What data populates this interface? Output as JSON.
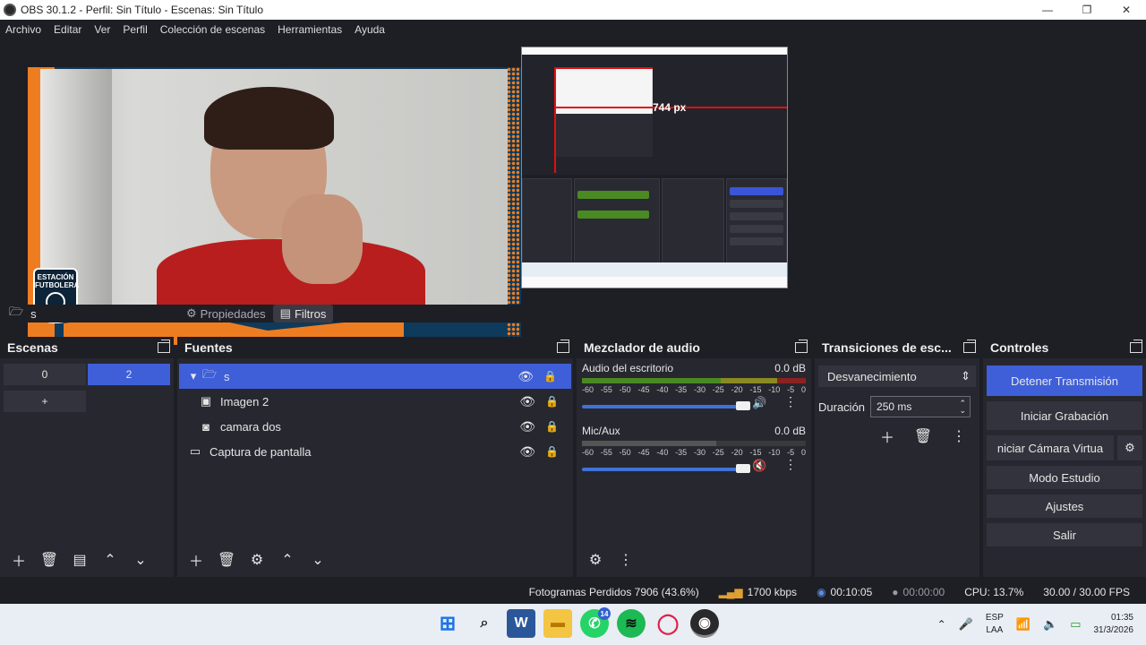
{
  "window": {
    "title": "OBS 30.1.2 - Perfil: Sin Título - Escenas: Sin Título",
    "minimize": "—",
    "maximize": "❐",
    "close": "✕"
  },
  "menu": {
    "items": [
      "Archivo",
      "Editar",
      "Ver",
      "Perfil",
      "Colección de escenas",
      "Herramientas",
      "Ayuda"
    ]
  },
  "preview": {
    "badge_line1": "ESTACIÓN",
    "badge_line2": "FUTBOLERA",
    "screen_label": "744 px"
  },
  "context": {
    "source_name": "s",
    "properties_label": "Propiedades",
    "filters_label": "Filtros"
  },
  "scenes": {
    "title": "Escenas",
    "buttons": [
      "0",
      "2",
      "+"
    ]
  },
  "sources": {
    "title": "Fuentes",
    "items": [
      {
        "name": "s",
        "icon": "folder-icon"
      },
      {
        "name": "Imagen 2",
        "icon": "image-icon"
      },
      {
        "name": "camara dos",
        "icon": "camera-icon"
      },
      {
        "name": "Captura de pantalla",
        "icon": "monitor-icon"
      }
    ]
  },
  "mixer": {
    "title": "Mezclador de audio",
    "tracks": [
      {
        "name": "Audio del escritorio",
        "level": "0.0 dB",
        "muted": false
      },
      {
        "name": "Mic/Aux",
        "level": "0.0 dB",
        "muted": true
      }
    ],
    "scale": [
      "-60",
      "-55",
      "-50",
      "-45",
      "-40",
      "-35",
      "-30",
      "-25",
      "-20",
      "-15",
      "-10",
      "-5",
      "0"
    ]
  },
  "transitions": {
    "title": "Transiciones de esc...",
    "selected": "Desvanecimiento",
    "duration_label": "Duración",
    "duration_value": "250 ms"
  },
  "controls": {
    "title": "Controles",
    "stop_stream": "Detener Transmisión",
    "start_record": "Iniciar Grabación",
    "virtual_cam": "niciar Cámara Virtua",
    "studio_mode": "Modo Estudio",
    "settings": "Ajustes",
    "exit": "Salir"
  },
  "status": {
    "dropped_frames": "Fotogramas Perdidos 7906 (43.6%)",
    "bitrate": "1700 kbps",
    "stream_time": "00:10:05",
    "record_time": "00:00:00",
    "cpu": "CPU: 13.7%",
    "fps": "30.00 / 30.00 FPS"
  },
  "taskbar": {
    "whatsapp_badge": "14",
    "lang_line1": "ESP",
    "lang_line2": "LAA",
    "time": "01:35",
    "date": "31/3/2026"
  },
  "colors": {
    "accent": "#3f5fd8",
    "brand_orange": "#ee7d22",
    "meter_green": "#4a8a22",
    "meter_yellow": "#8a8a22",
    "meter_red": "#8a2222"
  }
}
